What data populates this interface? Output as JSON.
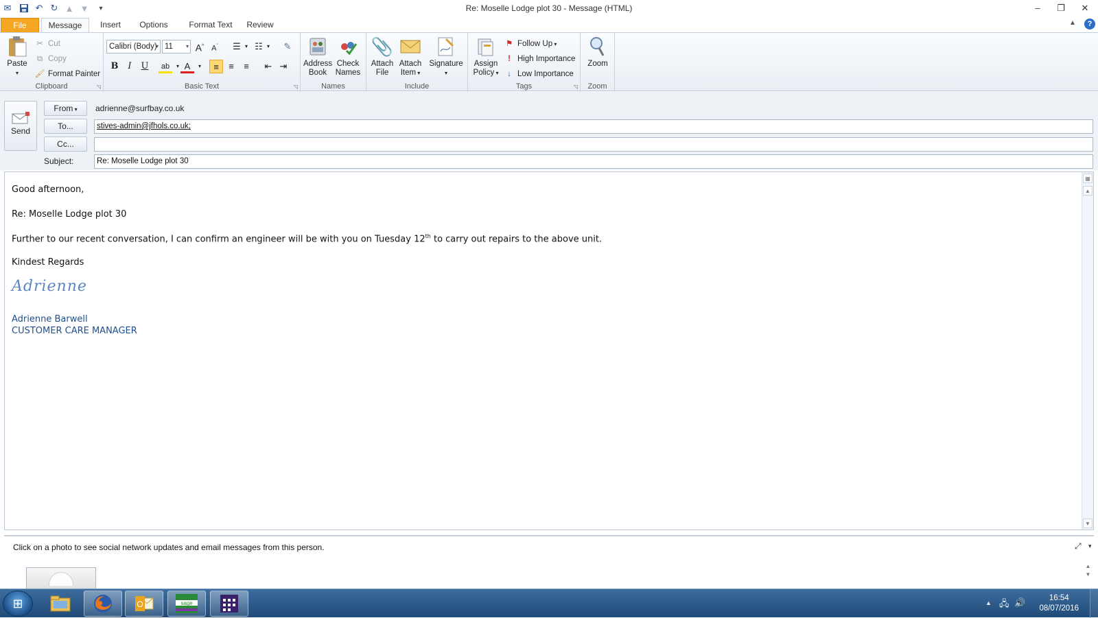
{
  "window": {
    "title": "Re: Moselle Lodge plot 30  -  Message (HTML)"
  },
  "tabs": [
    "File",
    "Message",
    "Insert",
    "Options",
    "Format Text",
    "Review"
  ],
  "ribbon": {
    "clipboard": {
      "label": "Clipboard",
      "paste": "Paste",
      "cut": "Cut",
      "copy": "Copy",
      "format_painter": "Format Painter"
    },
    "basic_text": {
      "label": "Basic Text",
      "font": "Calibri (Body)",
      "size": "11"
    },
    "names": {
      "label": "Names",
      "address_book_1": "Address",
      "address_book_2": "Book",
      "check_names_1": "Check",
      "check_names_2": "Names"
    },
    "include": {
      "label": "Include",
      "attach_file_1": "Attach",
      "attach_file_2": "File",
      "attach_item_1": "Attach",
      "attach_item_2": "Item",
      "signature": "Signature"
    },
    "tags": {
      "label": "Tags",
      "assign_policy_1": "Assign",
      "assign_policy_2": "Policy",
      "follow_up": "Follow Up",
      "high_importance": "High Importance",
      "low_importance": "Low Importance"
    },
    "zoom": {
      "label": "Zoom",
      "zoom": "Zoom"
    }
  },
  "header": {
    "send": "Send",
    "from_button": "From",
    "from_value": "adrienne@surfbay.co.uk",
    "to_button": "To...",
    "to_value": "stives-admin@jfhols.co.uk;",
    "cc_button": "Cc...",
    "cc_value": "",
    "subject_label": "Subject:",
    "subject_value": "Re: Moselle Lodge plot 30"
  },
  "body": {
    "greeting": "Good afternoon,",
    "re_line": "Re: Moselle Lodge plot 30",
    "para_before": "Further to our recent conversation, I can confirm an engineer will be with you on Tuesday 12",
    "para_sup": "th",
    "para_after": " to carry out repairs to the above unit.",
    "closing": "Kindest Regards",
    "signature_script": "Adrienne",
    "signature_name": "Adrienne Barwell",
    "signature_title": "CUSTOMER CARE MANAGER"
  },
  "people_pane": {
    "info": "Click on a photo to see social network updates and email messages from this person."
  },
  "taskbar": {
    "time": "16:54",
    "date": "08/07/2016"
  }
}
